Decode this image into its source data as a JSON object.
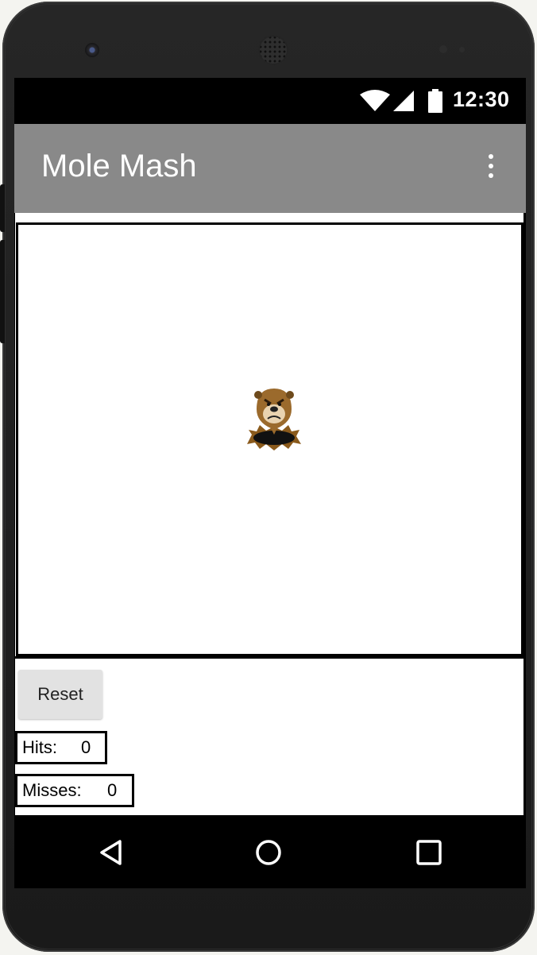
{
  "status_bar": {
    "time": "12:30",
    "icons": [
      "wifi-icon",
      "signal-icon",
      "battery-icon"
    ]
  },
  "app_bar": {
    "title": "Mole Mash",
    "menu_icon": "overflow-menu-icon",
    "color": "#898989"
  },
  "canvas": {
    "sprite": "mole-icon"
  },
  "controls": {
    "reset_label": "Reset",
    "hits_label": "Hits:",
    "hits_value": "0",
    "misses_label": "Misses:",
    "misses_value": "0"
  },
  "nav_bar": {
    "icons": [
      "back-icon",
      "home-icon",
      "recents-icon"
    ]
  }
}
